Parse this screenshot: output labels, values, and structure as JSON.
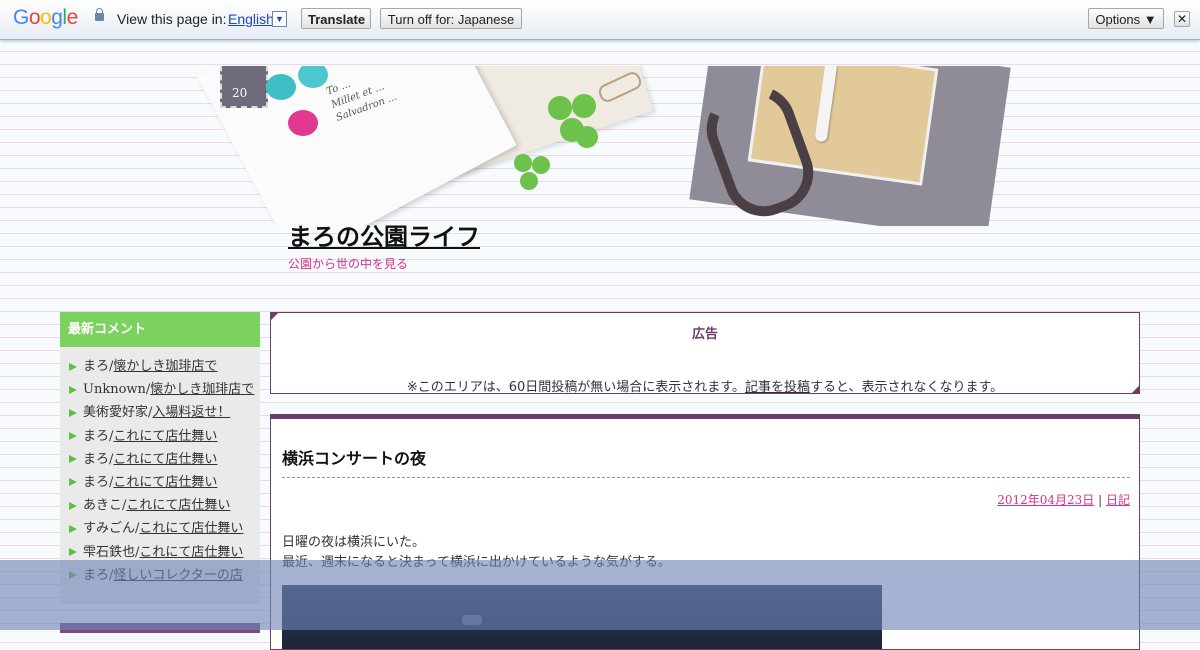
{
  "translate_bar": {
    "logo": "Google",
    "view_text": "View this page in:",
    "language": "English",
    "translate_label": "Translate",
    "turn_off_label": "Turn off for: Japanese",
    "options_label": "Options ▼",
    "close_label": "✕",
    "colors": {
      "blue": "#4285f4",
      "red": "#ea4335",
      "yellow": "#fbbc05",
      "green": "#34a853"
    }
  },
  "header": {
    "site_title": "まろの公園ライフ",
    "site_description": "公園から世の中を見る",
    "stamp_number": "20",
    "script_lines": [
      "To ...",
      "Millet et ...",
      "Salvadron ..."
    ]
  },
  "sidebar": {
    "title": "最新コメント",
    "items": [
      {
        "author": "まろ/",
        "link": "懐かしき珈琲店で"
      },
      {
        "author": "Unknown/",
        "link": "懐かしき珈琲店で"
      },
      {
        "author": "美術愛好家/",
        "link": "入場料返せ！"
      },
      {
        "author": "まろ/",
        "link": "これにて店仕舞い"
      },
      {
        "author": "まろ/",
        "link": "これにて店仕舞い"
      },
      {
        "author": "まろ/",
        "link": "これにて店仕舞い"
      },
      {
        "author": "あきこ/",
        "link": "これにて店仕舞い"
      },
      {
        "author": "すみごん/",
        "link": "これにて店仕舞い"
      },
      {
        "author": "雫石鉄也/",
        "link": "これにて店仕舞い"
      },
      {
        "author": "まろ/",
        "link": "怪しいコレクターの店"
      }
    ]
  },
  "ad": {
    "title": "広告",
    "note_before": "※このエリアは、60日間投稿が無い場合に表示されます。",
    "note_link": "記事を投稿",
    "note_after": "すると、表示されなくなります。"
  },
  "post": {
    "title": "横浜コンサートの夜",
    "date": "2012年04月23日",
    "separator": " | ",
    "category": "日記",
    "body_lines": [
      "日曜の夜は横浜にいた。",
      "最近、週末になると決まって横浜に出かけているような気がする。"
    ]
  }
}
